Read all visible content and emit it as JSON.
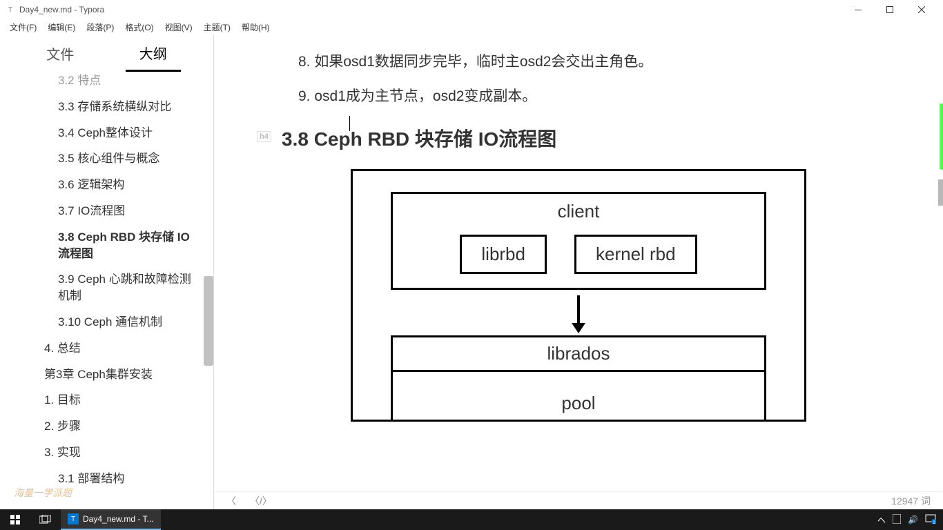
{
  "window": {
    "title": "Day4_new.md - Typora"
  },
  "menu": {
    "file": "文件(F)",
    "edit": "编辑(E)",
    "para": "段落(P)",
    "format": "格式(O)",
    "view": "视图(V)",
    "theme": "主题(T)",
    "help": "帮助(H)"
  },
  "sidebar": {
    "tab_files": "文件",
    "tab_outline": "大纲",
    "items": [
      {
        "label": "3.2 特点",
        "level": 2,
        "cut": true
      },
      {
        "label": "3.3 存储系统横纵对比",
        "level": 2
      },
      {
        "label": "3.4 Ceph整体设计",
        "level": 2
      },
      {
        "label": "3.5 核心组件与概念",
        "level": 2
      },
      {
        "label": "3.6 逻辑架构",
        "level": 2
      },
      {
        "label": "3.7 IO流程图",
        "level": 2
      },
      {
        "label": "3.8 Ceph RBD 块存储 IO流程图",
        "level": 2,
        "active": true
      },
      {
        "label": "3.9 Ceph 心跳和故障检测机制",
        "level": 2
      },
      {
        "label": "3.10 Ceph 通信机制",
        "level": 2
      },
      {
        "label": "4. 总结",
        "level": 1
      },
      {
        "label": "第3章 Ceph集群安装",
        "level": 1
      },
      {
        "label": "1. 目标",
        "level": 1
      },
      {
        "label": "2. 步骤",
        "level": 1
      },
      {
        "label": "3. 实现",
        "level": 1
      },
      {
        "label": "3.1 部署结构",
        "level": 2
      }
    ]
  },
  "content": {
    "list": [
      {
        "num": "8.",
        "text": "如果osd1数据同步完毕，临时主osd2会交出主角色。"
      },
      {
        "num": "9.",
        "text": "osd1成为主节点，osd2变成副本。"
      }
    ],
    "h_badge": "h4",
    "heading": "3.8 Ceph RBD 块存储 IO流程图",
    "diagram": {
      "client": "client",
      "librbd": "librbd",
      "kernel_rbd": "kernel rbd",
      "librados": "librados",
      "pool": "pool"
    }
  },
  "status": {
    "wordcount": "12947 词"
  },
  "taskbar": {
    "app_title": "Day4_new.md - T..."
  },
  "watermark": "海量一学派题"
}
